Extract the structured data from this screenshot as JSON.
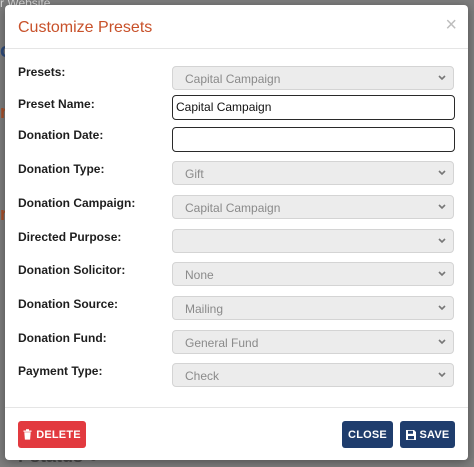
{
  "background": {
    "top_text": "r Website",
    "left_text_1": "o",
    "left_text_2": "r",
    "left_text_3": "r",
    "bottom_text": "r status ●"
  },
  "modal": {
    "title": "Customize Presets",
    "close_glyph": "×",
    "fields": {
      "presets": {
        "label": "Presets:",
        "value": "Capital Campaign"
      },
      "preset_name": {
        "label": "Preset Name:",
        "value": "Capital Campaign"
      },
      "donation_date": {
        "label": "Donation Date:",
        "value": ""
      },
      "donation_type": {
        "label": "Donation Type:",
        "value": "Gift"
      },
      "donation_campaign": {
        "label": "Donation Campaign:",
        "value": "Capital Campaign"
      },
      "directed_purpose": {
        "label": "Directed Purpose:",
        "value": ""
      },
      "donation_solicitor": {
        "label": "Donation Solicitor:",
        "value": "None"
      },
      "donation_source": {
        "label": "Donation Source:",
        "value": "Mailing"
      },
      "donation_fund": {
        "label": "Donation Fund:",
        "value": "General Fund"
      },
      "payment_type": {
        "label": "Payment Type:",
        "value": "Check"
      }
    },
    "footer": {
      "delete_label": "DELETE",
      "close_label": "CLOSE",
      "save_label": "SAVE"
    }
  },
  "colors": {
    "title": "#c8512a",
    "delete_button": "#e23a3f",
    "primary_button": "#1f3d6d"
  },
  "icons": [
    "close-icon",
    "chevron-down-icon",
    "trash-icon",
    "floppy-disk-icon"
  ]
}
